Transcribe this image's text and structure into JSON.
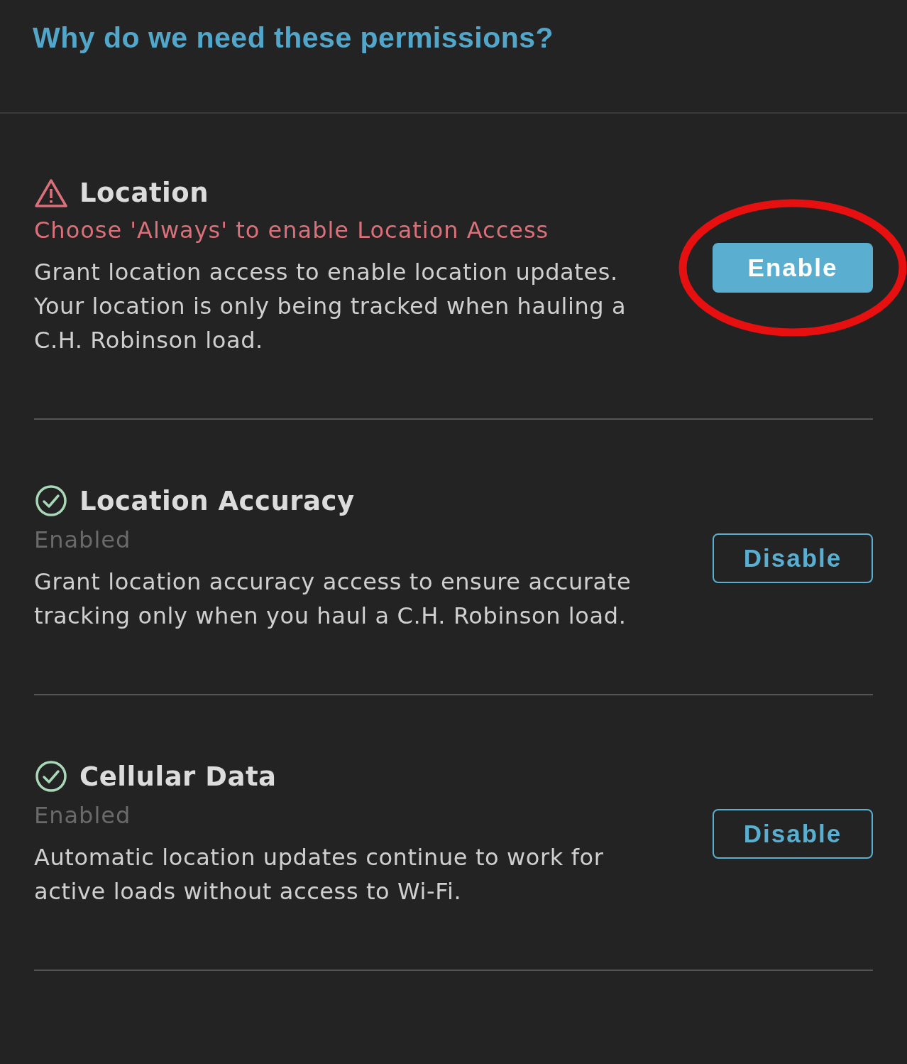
{
  "header": {
    "title": "Why do we need these permissions?"
  },
  "permissions": [
    {
      "title": "Location",
      "kind": "warning",
      "status_text": "Choose 'Always' to enable Location Access",
      "description": "Grant location access to enable location updates. Your location is only being tracked when hauling a C.H. Robinson load.",
      "button": {
        "label": "Enable",
        "kind": "filled",
        "circled": true
      }
    },
    {
      "title": "Location Accuracy",
      "kind": "ok",
      "status_text": "Enabled",
      "description": "Grant location accuracy access to ensure accurate tracking only when you haul a C.H. Robinson load.",
      "button": {
        "label": "Disable",
        "kind": "outline",
        "circled": false
      }
    },
    {
      "title": "Cellular Data",
      "kind": "ok",
      "status_text": "Enabled",
      "description": "Automatic location updates continue to work for active loads without access to Wi-Fi.",
      "button": {
        "label": "Disable",
        "kind": "outline",
        "circled": false
      }
    }
  ]
}
